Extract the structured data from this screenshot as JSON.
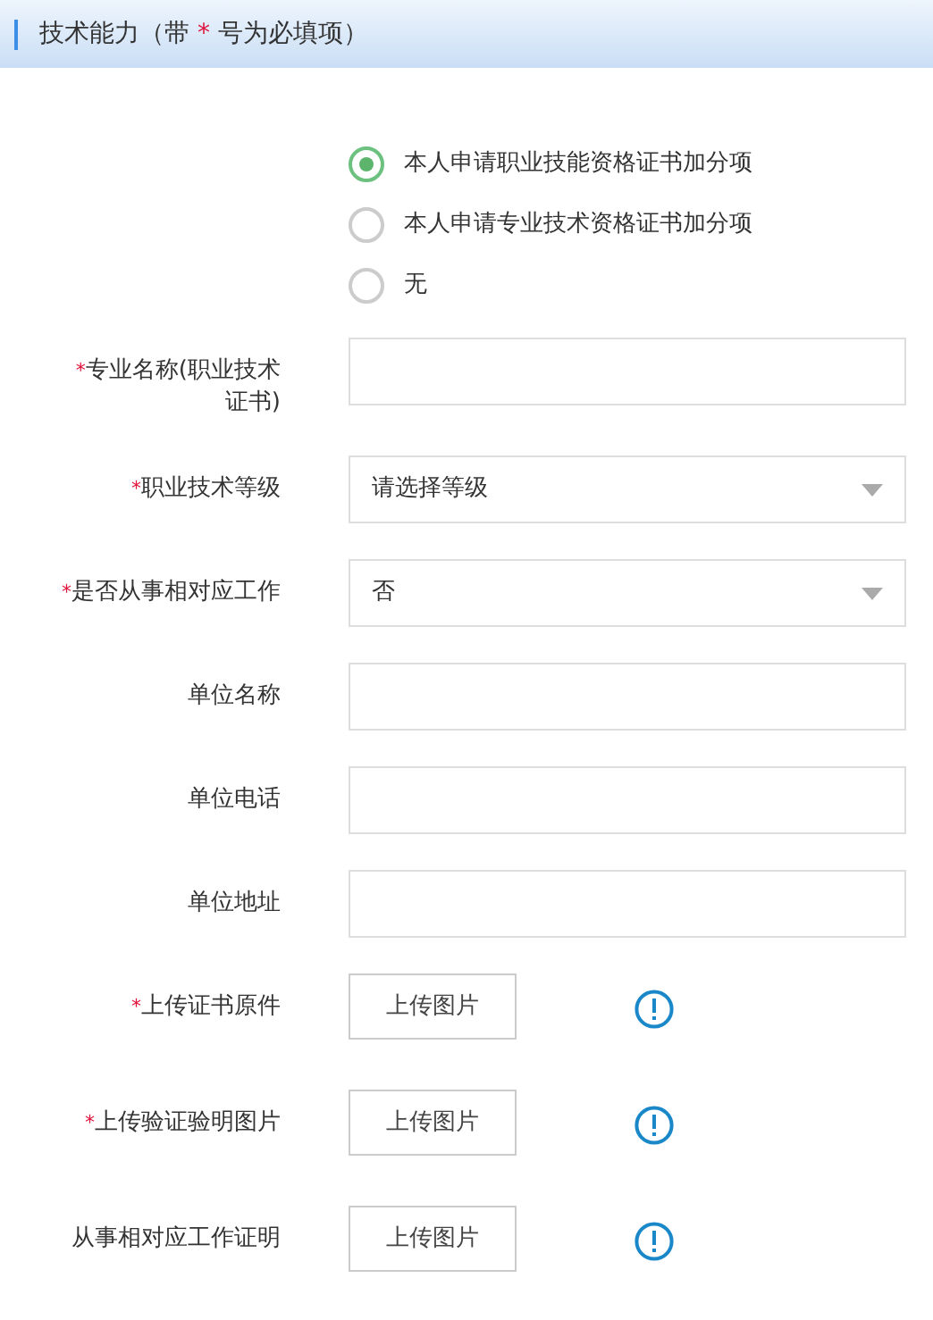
{
  "header": {
    "title": "技术能力（带",
    "required_mark": "*",
    "title_end": "号为必填项）"
  },
  "options": [
    {
      "label": "本人申请职业技能资格证书加分项",
      "selected": true
    },
    {
      "label": "本人申请专业技术资格证书加分项",
      "selected": false
    },
    {
      "label": "无",
      "selected": false
    }
  ],
  "fields": [
    {
      "kind": "text",
      "required_mark": "*",
      "label": "专业名称(职业技术证书)"
    },
    {
      "kind": "select",
      "required_mark": "*",
      "label": "职业技术等级",
      "value": "请选择等级"
    },
    {
      "kind": "select",
      "required_mark": "*",
      "label": "是否从事相对应工作",
      "value": "否"
    },
    {
      "kind": "text",
      "label": "单位名称"
    },
    {
      "kind": "text",
      "label": "单位电话"
    },
    {
      "kind": "text",
      "label": "单位地址"
    },
    {
      "kind": "upload",
      "required_mark": "*",
      "label": "上传证书原件",
      "button": "上传图片"
    },
    {
      "kind": "upload",
      "required_mark": "*",
      "label": "上传验证验明图片",
      "button": "上传图片"
    },
    {
      "kind": "upload",
      "label": "从事相对应工作证明",
      "button": "上传图片"
    }
  ]
}
